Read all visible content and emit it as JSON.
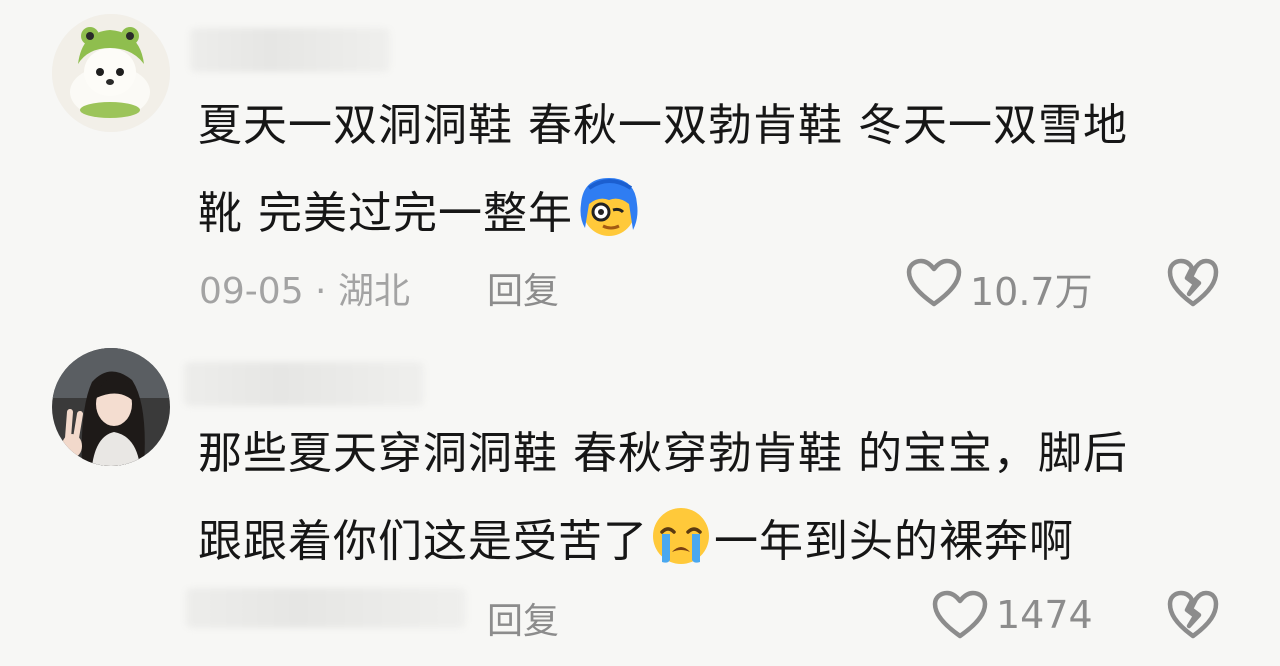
{
  "comments": [
    {
      "text_line1": "夏天一双洞洞鞋 春秋一双勃肯鞋 冬天一双雪地",
      "text_line2": "靴 完美过完一整年",
      "meta": "09-05 · 湖北",
      "reply_label": "回复",
      "like_count": "10.7万",
      "avatar_icon": "dog-in-frog-hat-avatar",
      "emoji_icon": "blue-hair-monocle-emoji"
    },
    {
      "text_line1": "那些夏天穿洞洞鞋 春秋穿勃肯鞋 的宝宝，脚后",
      "text_line2_a": "跟跟着你们这是受苦了",
      "text_line2_b": "一年到头的裸奔啊",
      "meta": "",
      "reply_label": "回复",
      "like_count": "1474",
      "avatar_icon": "girl-selfie-avatar",
      "emoji_icon": "crying-face-emoji"
    }
  ],
  "colors": {
    "background": "#f7f7f5",
    "text": "#161616",
    "meta": "#a3a3a3",
    "icon": "#8c8c8c"
  }
}
